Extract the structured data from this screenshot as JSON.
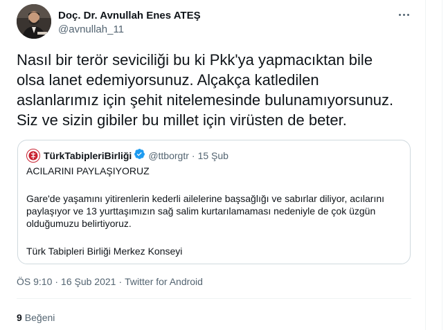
{
  "author": {
    "name": "Doç. Dr. Avnullah Enes ATEŞ",
    "handle": "@avnullah_11"
  },
  "tweet": {
    "text": "Nasıl bir terör seviciliği bu ki Pkk'ya yapmacıktan bile\nolsa lanet edemiyorsunuz. Alçakça katledilen\naslanlarımız için şehit nitelemesinde bulunamıyorsunuz.\nSiz ve sizin gibiler bu millet için virüsten de beter."
  },
  "quote": {
    "name": "TürkTabipleriBirliği",
    "handle": "@ttborgtr",
    "dot": "·",
    "date": "15 Şub",
    "headline": "ACILARINI PAYLAŞIYORUZ",
    "body": "Gare'de yaşamını yitirenlerin kederli ailelerine başsağlığı ve sabırlar diliyor, acılarını paylaşıyor ve 13 yurttaşımızın sağ salim kurtarılamaması nedeniyle de çok üzgün olduğumuzu belirtiyoruz.",
    "signature": "Türk Tabipleri Birliği Merkez Konseyi"
  },
  "meta": {
    "time": "ÖS 9:10",
    "sep": "·",
    "date": "16 Şub 2021",
    "source": "Twitter for Android"
  },
  "likes": {
    "count": "9",
    "label": "Beğeni"
  },
  "colors": {
    "text": "#0f1419",
    "secondary": "#536471",
    "border": "#cfd9de",
    "verified": "#1d9bf0"
  },
  "icons": {
    "avatar": "profile-photo",
    "more": "more-dots-icon",
    "verified": "verified-badge-icon",
    "quote_logo": "ttb-logo"
  }
}
